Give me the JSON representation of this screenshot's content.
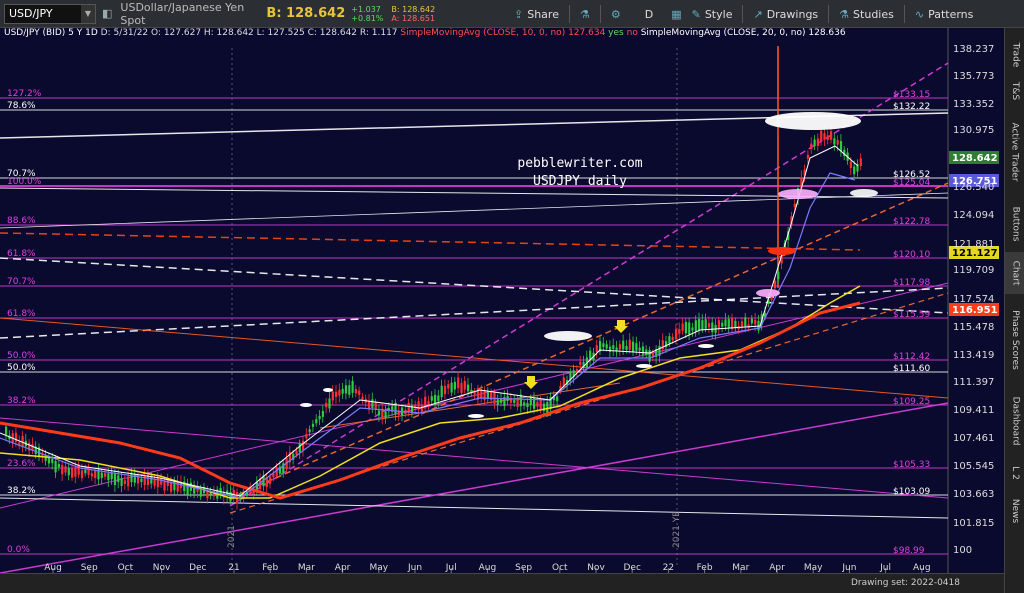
{
  "toolbar": {
    "symbol": "USD/JPY",
    "description": "USDollar/Japanese Yen Spot",
    "bid_label": "B: 128.642",
    "change_abs": "+1.037",
    "change_pct": "+0.81%",
    "bid_small": "B: 128.642",
    "ask_small": "A: 128.651",
    "share": "Share",
    "period": "D",
    "style": "Style",
    "drawings": "Drawings",
    "studies": "Studies",
    "patterns": "Patterns"
  },
  "infobar": {
    "prefix": "USD/JPY (BID) 5 Y 1D",
    "ohlc": "D: 5/31/22  O: 127.627  H: 128.642  L: 127.525  C: 128.642  R: 1.117",
    "sma10_label": "SimpleMovingAvg (CLOSE, 10, 0, no)",
    "sma10_value": "127.634",
    "sma10_flags": "yes",
    "sma10_flags2": "no",
    "sma20_label": "SimpleMovingAvg (CLOSE, 20, 0, no)",
    "sma20_value": "128.636"
  },
  "watermark": {
    "line1": "pebblewriter.com",
    "line2": "USDJPY daily"
  },
  "price_axis": [
    "138.237",
    "135.773",
    "133.352",
    "130.975",
    "126.540",
    "124.094",
    "121.881",
    "119.709",
    "117.574",
    "115.478",
    "113.419",
    "111.397",
    "109.411",
    "107.461",
    "105.545",
    "103.663",
    "101.815",
    "100"
  ],
  "current_labels": {
    "price": "128.642",
    "sma_blue": "126.751",
    "sma_yellow": "121.127",
    "sma_red": "116.951"
  },
  "time_axis": [
    "Aug",
    "Sep",
    "Oct",
    "Nov",
    "Dec",
    "21",
    "Feb",
    "Mar",
    "Apr",
    "May",
    "Jun",
    "Jul",
    "Aug",
    "Sep",
    "Oct",
    "Nov",
    "Dec",
    "22",
    "Feb",
    "Mar",
    "Apr",
    "May",
    "Jun",
    "Jul",
    "Aug"
  ],
  "fib_left": [
    "127.2%",
    "78.6%",
    "70.7%",
    "100.0%",
    "88.6%",
    "61.8%",
    "70.7%",
    "61.8%",
    "50.0%",
    "50.0%",
    "38.2%",
    "23.6%",
    "38.2%",
    "0.0%"
  ],
  "fib_right": [
    "$133.15",
    "$132.22",
    "$126.52",
    "$125.04",
    "$122.78",
    "$120.10",
    "$117.98",
    "$115.59",
    "$112.42",
    "$111.60",
    "$109.25",
    "$105.33",
    "$103.09",
    "$98.99"
  ],
  "year_markers": [
    "2021",
    "2021 YE"
  ],
  "sidetabs": [
    "Trade",
    "T&S",
    "Active Trader",
    "Buttons",
    "Chart",
    "Phase Scores",
    "Dashboard",
    "L 2",
    "News"
  ],
  "drawing_set": "Drawing set: 2022-0418",
  "colors": {
    "background": "#0a0a2e",
    "fib_magenta": "#e040e0",
    "sma_red": "#ff3b1a",
    "sma_yellow": "#f0e020",
    "sma_blue": "#7a7aff",
    "sma_white": "#ffffff",
    "price_up": "#2ecc40",
    "price_down": "#ff3030"
  }
}
